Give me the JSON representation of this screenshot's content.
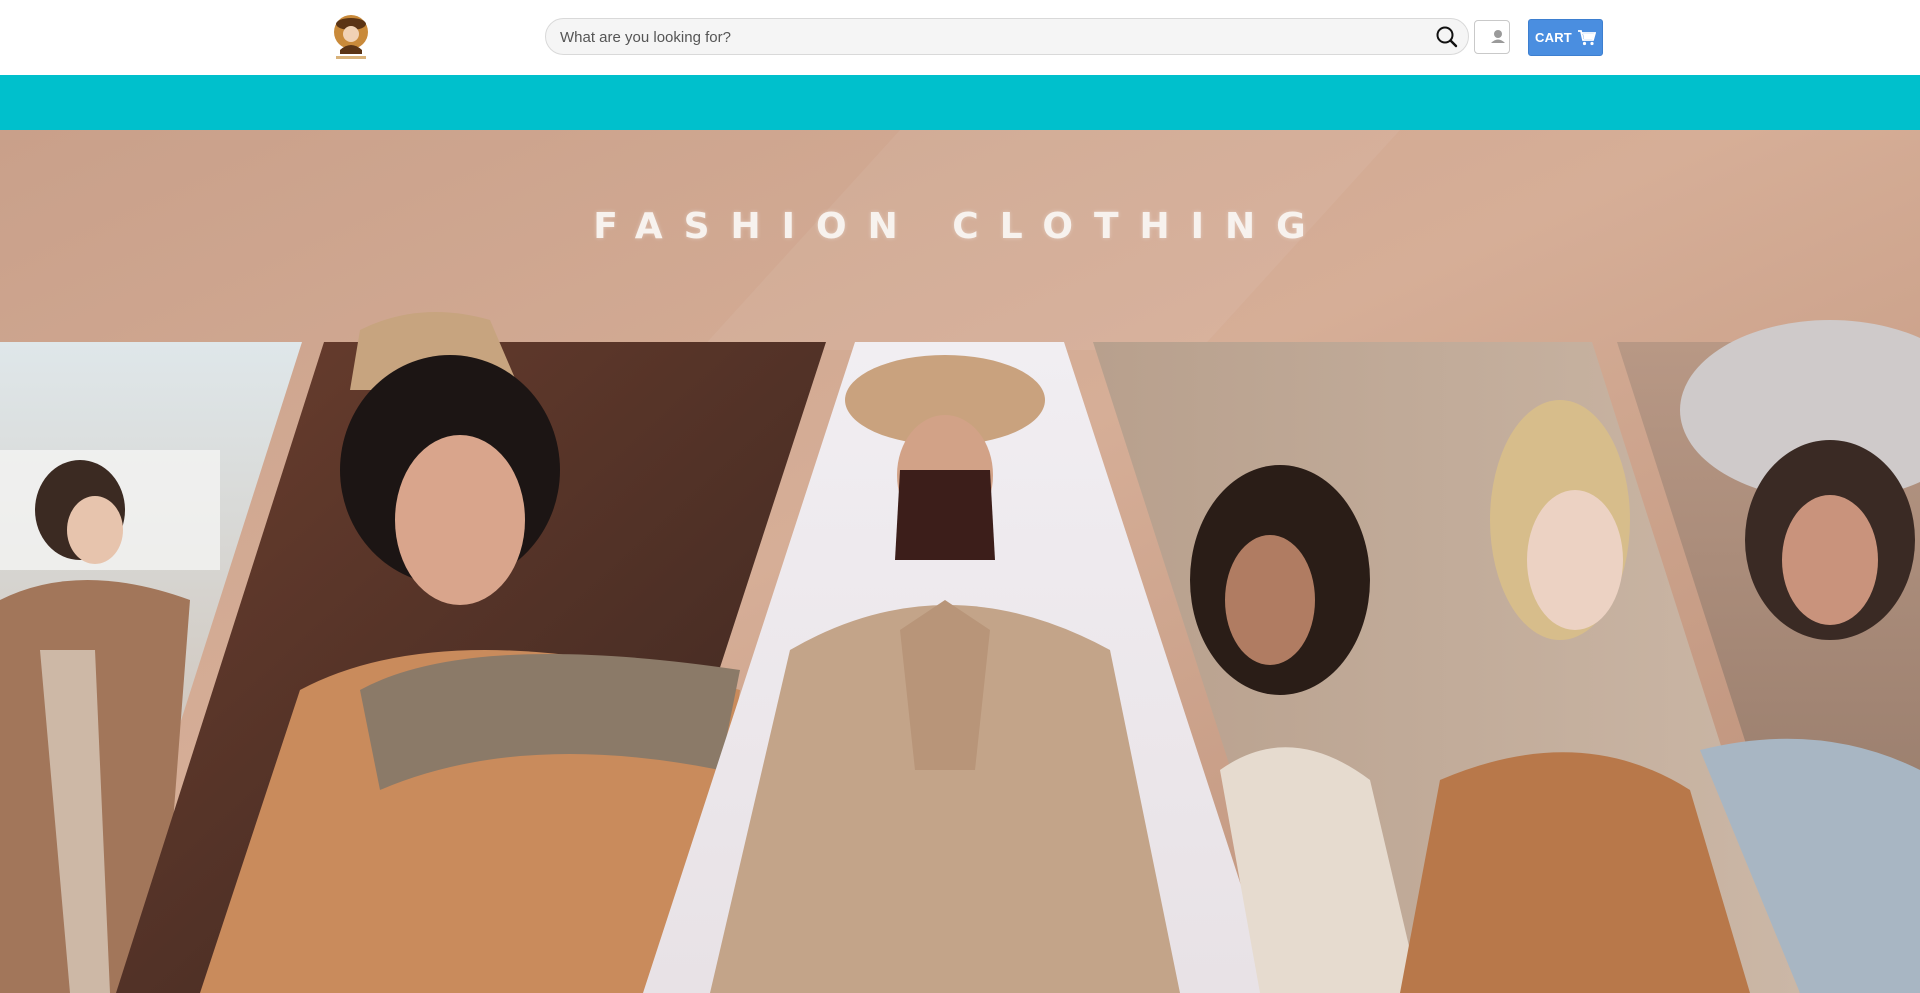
{
  "header": {
    "logo_icon": "woman-with-hat-logo-icon",
    "search": {
      "placeholder": "What are you looking for?",
      "value": "",
      "icon": "search-icon"
    },
    "account_icon": "user-icon",
    "cart": {
      "label": "CART",
      "icon": "cart-icon"
    }
  },
  "promo_bar": {
    "color": "#00c0cc"
  },
  "hero": {
    "title": "FASHION CLOTHING",
    "background_color": "#c9a08a",
    "images": [
      "woman-in-trench-coat-image",
      "woman-in-fur-collar-coat-image",
      "woman-in-beret-and-cape-image",
      "two-women-in-coats-image",
      "woman-in-wide-brim-hat-image"
    ]
  },
  "colors": {
    "accent": "#4a8ee0",
    "teal": "#00c0cc",
    "hero_bg": "#c9a08a"
  }
}
